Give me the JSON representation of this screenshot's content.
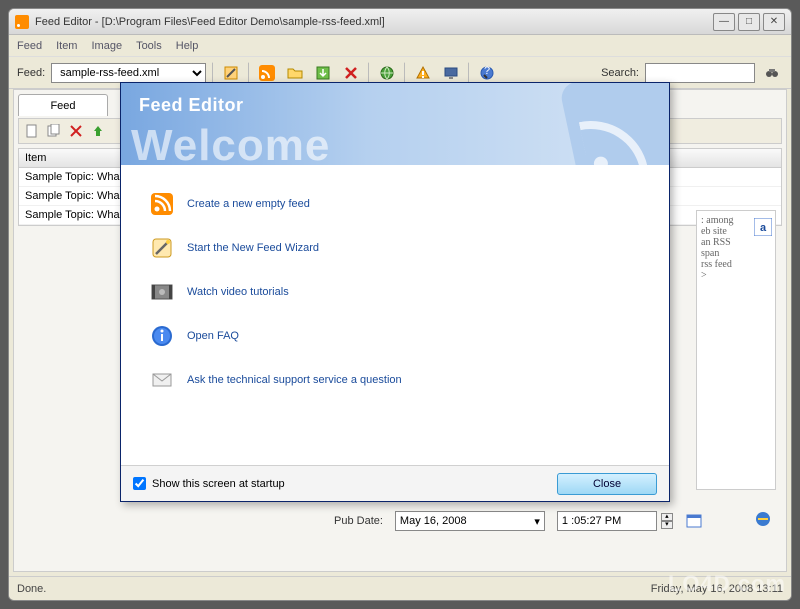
{
  "window": {
    "title": "Feed Editor - [D:\\Program Files\\Feed Editor Demo\\sample-rss-feed.xml]"
  },
  "menu": {
    "items": [
      "Feed",
      "Item",
      "Image",
      "Tools",
      "Help"
    ]
  },
  "toolbar": {
    "feed_label": "Feed:",
    "feed_selected": "sample-rss-feed.xml",
    "search_label": "Search:"
  },
  "tabs": {
    "feed": "Feed"
  },
  "item_table": {
    "header": "Item",
    "rows": [
      "Sample Topic: Wha",
      "Sample Topic: Wha",
      "Sample Topic: Wha"
    ]
  },
  "right_panel_snippet": ": among\neb site\nan RSS\nspan\nrss feed\n>",
  "bottom": {
    "pubdate_label": "Pub Date:",
    "date_value": "May      16, 2008",
    "time_value": "1 :05:27 PM"
  },
  "status": {
    "left": "Done.",
    "right": "Friday, May 16, 2008 13:11"
  },
  "dialog": {
    "brand": "Feed Editor",
    "welcome": "Welcome",
    "options": [
      "Create a new empty feed",
      "Start the New Feed Wizard",
      "Watch video tutorials",
      "Open FAQ",
      "Ask the technical support service a question"
    ],
    "show_at_startup": "Show this screen at startup",
    "close": "Close"
  },
  "watermark": "LO4D.com"
}
